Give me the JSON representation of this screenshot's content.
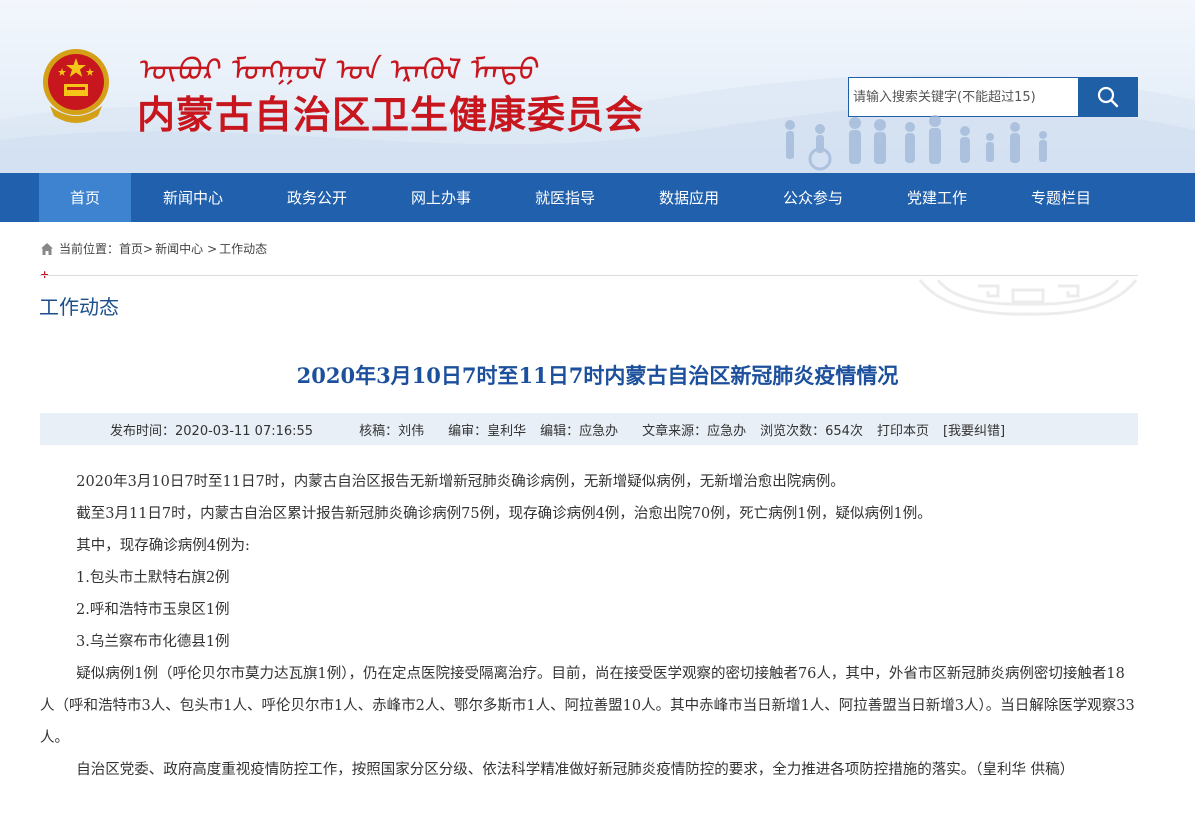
{
  "header": {
    "mongolian_title": "ᠥᠪᠦᠷ ᠮᠣᠩᠭᠣᠯ ᠤᠨ ᠡᠷᠡᠭᠦᠯ ᠮᠡᠨᠳᠦ",
    "site_title": "内蒙古自治区卫生健康委员会",
    "search": {
      "placeholder": "请输入搜索关键字(不能超过15)",
      "button_icon": "search-icon"
    },
    "brand_color": "#c7161d"
  },
  "nav": {
    "items": [
      "首页",
      "新闻中心",
      "政务公开",
      "网上办事",
      "就医指导",
      "数据应用",
      "公众参与",
      "党建工作",
      "专题栏目"
    ],
    "active_index": 0,
    "bg_color": "#2060ad",
    "active_color": "#3d83d0"
  },
  "breadcrumb": {
    "prefix": "当前位置：",
    "items": [
      "首页>",
      "新闻中心",
      ">",
      "工作动态"
    ]
  },
  "section_title": "工作动态",
  "article": {
    "title": "2020年3月10日7时至11日7时内蒙古自治区新冠肺炎疫情情况",
    "meta": {
      "publish_time": "发布时间：2020-03-11 07:16:55",
      "reviewer": "核稿：刘伟",
      "editor": "编审：皇利华",
      "editor2": "编辑：应急办",
      "source": "文章来源：应急办",
      "views": "浏览次数：654次",
      "print": "打印本页",
      "report_error": "[我要纠错]"
    },
    "paragraphs": {
      "p1": "2020年3月10日7时至11日7时，内蒙古自治区报告无新增新冠肺炎确诊病例，无新增疑似病例，无新增治愈出院病例。",
      "p2": "截至3月11日7时，内蒙古自治区累计报告新冠肺炎确诊病例75例，现存确诊病例4例，治愈出院70例，死亡病例1例，疑似病例1例。",
      "p3": "其中，现存确诊病例4例为:",
      "list": [
        "1.包头市土默特右旗2例",
        "2.呼和浩特市玉泉区1例",
        "3.乌兰察布市化德县1例"
      ],
      "p4": "疑似病例1例（呼伦贝尔市莫力达瓦旗1例），仍在定点医院接受隔离治疗。目前，尚在接受医学观察的密切接触者76人，其中，外省市区新冠肺炎病例密切接触者18人（呼和浩特市3人、包头市1人、呼伦贝尔市1人、赤峰市2人、鄂尔多斯市1人、阿拉善盟10人。其中赤峰市当日新增1人、阿拉善盟当日新增3人）。当日解除医学观察33人。",
      "p5": "自治区党委、政府高度重视疫情防控工作，按照国家分区分级、依法科学精准做好新冠肺炎疫情防控的要求，全力推进各项防控措施的落实。（皇利华 供稿）"
    }
  }
}
